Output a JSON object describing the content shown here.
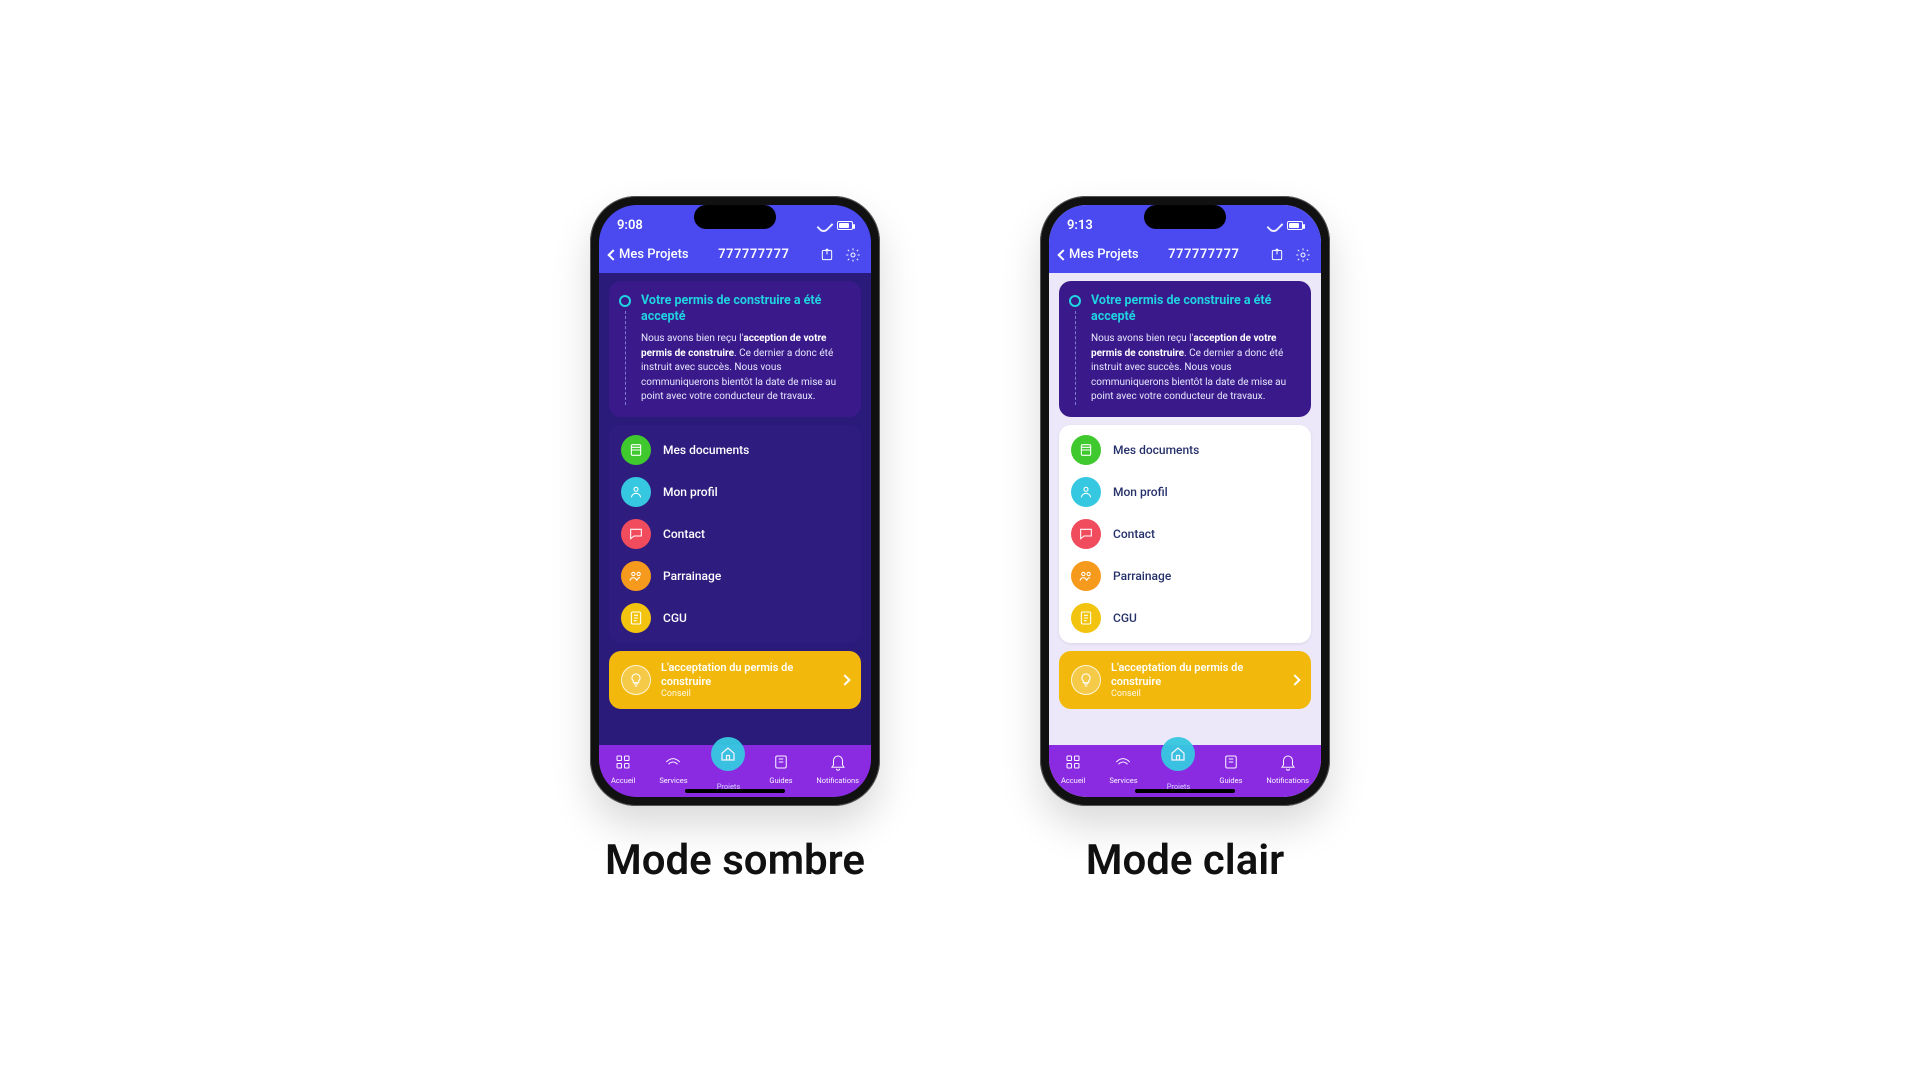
{
  "captions": {
    "dark": "Mode sombre",
    "light": "Mode clair"
  },
  "phones": {
    "dark": {
      "time": "9:08"
    },
    "light": {
      "time": "9:13"
    }
  },
  "header": {
    "back_label": "Mes Projets",
    "title": "777777777"
  },
  "notice": {
    "title": "Votre permis de construire a été accepté",
    "body_pre": "Nous avons bien reçu l'",
    "body_bold": "acception de votre permis de construire",
    "body_post": ". Ce dernier a donc été instruit avec succès. Nous vous communiquerons bientôt la date de mise au point avec votre conducteur de travaux."
  },
  "menu": [
    {
      "id": "documents",
      "label": "Mes documents",
      "color": "b-green",
      "icon": "doc"
    },
    {
      "id": "profile",
      "label": "Mon profil",
      "color": "b-cyan",
      "icon": "person"
    },
    {
      "id": "contact",
      "label": "Contact",
      "color": "b-red",
      "icon": "chat"
    },
    {
      "id": "parrainage",
      "label": "Parrainage",
      "color": "b-orange",
      "icon": "people"
    },
    {
      "id": "cgu",
      "label": "CGU",
      "color": "b-yellow",
      "icon": "sheet"
    }
  ],
  "tip": {
    "title": "L'acceptation du permis de construire",
    "subtitle": "Conseil"
  },
  "tabs": [
    {
      "id": "accueil",
      "label": "Accueil"
    },
    {
      "id": "services",
      "label": "Services"
    },
    {
      "id": "projets",
      "label": "Projets"
    },
    {
      "id": "guides",
      "label": "Guides"
    },
    {
      "id": "notifications",
      "label": "Notifications"
    }
  ]
}
